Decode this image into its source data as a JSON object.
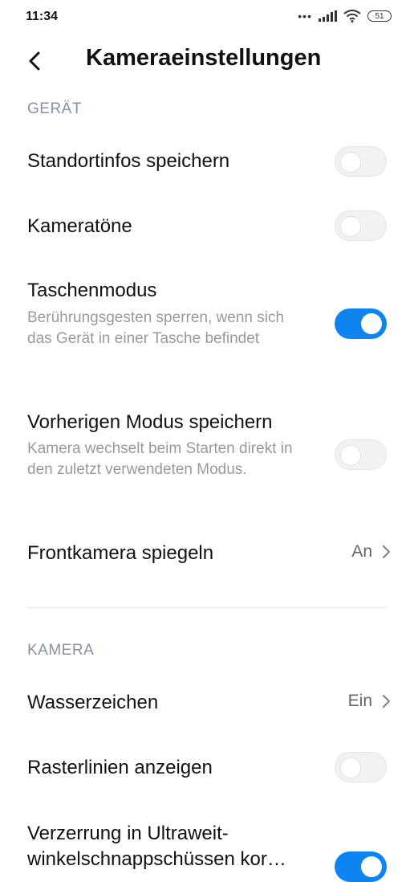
{
  "status_bar": {
    "time": "11:34",
    "battery_level": "51"
  },
  "header": {
    "title": "Kameraeinstellungen"
  },
  "sections": {
    "device": {
      "title": "GERÄT",
      "location": {
        "label": "Standortinfos speichern",
        "toggle_state": "off"
      },
      "sounds": {
        "label": "Kameratöne",
        "toggle_state": "off"
      },
      "pocket": {
        "label": "Taschenmodus",
        "description": "Berührungsgesten sperren, wenn sich das Gerät in einer Tasche befindet",
        "toggle_state": "on"
      },
      "previous_mode": {
        "label": "Vorherigen Modus speichern",
        "description": "Kamera wechselt beim Starten direkt in den zuletzt verwendeten Modus.",
        "toggle_state": "off"
      },
      "mirror": {
        "label": "Frontkamera spiegeln",
        "value": "An"
      }
    },
    "camera": {
      "title": "KAMERA",
      "watermark": {
        "label": "Wasserzeichen",
        "value": "Ein"
      },
      "grid": {
        "label": "Rasterlinien anzeigen",
        "toggle_state": "off"
      },
      "distortion": {
        "label": "Verzerrung in Ultraweit-winkelschnappschüssen kor…",
        "toggle_state": "on"
      }
    }
  },
  "colors": {
    "accent": "#0e84f1",
    "section_title": "#8a8fa8",
    "description": "#999999"
  }
}
